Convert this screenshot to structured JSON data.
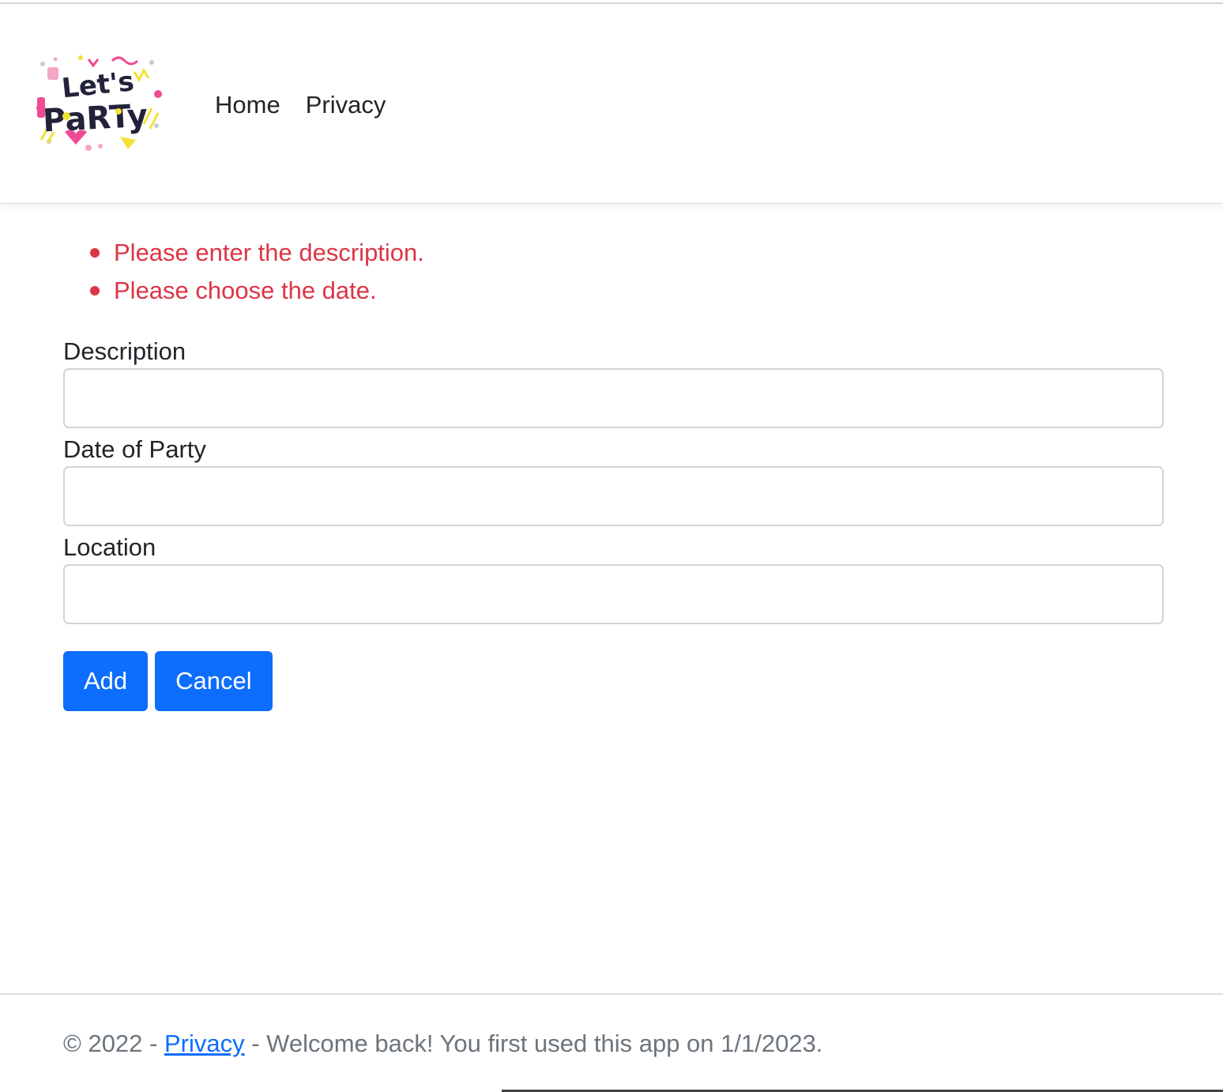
{
  "nav": {
    "brand_alt": "Let's Party",
    "links": [
      "Home",
      "Privacy"
    ]
  },
  "validation": {
    "errors": [
      "Please enter the description.",
      "Please choose the date."
    ]
  },
  "form": {
    "description": {
      "label": "Description",
      "value": ""
    },
    "date": {
      "label": "Date of Party",
      "value": ""
    },
    "location": {
      "label": "Location",
      "value": ""
    }
  },
  "actions": {
    "add": "Add",
    "cancel": "Cancel"
  },
  "footer": {
    "prefix": "© 2022 - ",
    "privacy_link": "Privacy",
    "message": " - Welcome back! You first used this app on 1/1/2023."
  },
  "colors": {
    "primary": "#0d6efd",
    "error": "#dc3545",
    "muted": "#6c757d"
  }
}
